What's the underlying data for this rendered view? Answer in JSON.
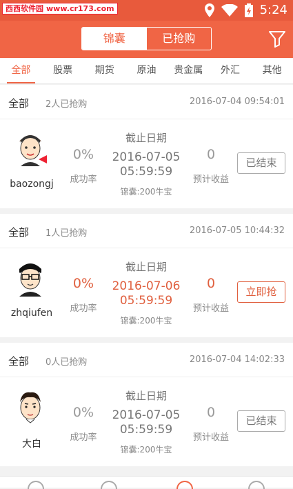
{
  "status_bar": {
    "watermark_left": "西西软件园",
    "watermark_site": "www.cr173.com",
    "time": "5:24"
  },
  "appbar": {
    "seg_left": "锦囊",
    "seg_right": "已抢购"
  },
  "tabs": [
    "全部",
    "股票",
    "期货",
    "原油",
    "贵金属",
    "外汇",
    "其他"
  ],
  "cards": [
    {
      "category": "全部",
      "count": "2人已抢购",
      "timestamp": "2016-07-04 09:54:01",
      "username": "baozongj",
      "rate": "0%",
      "rate_label": "成功率",
      "deadline_label": "截止日期",
      "deadline_date": "2016-07-05",
      "deadline_time": "05:59:59",
      "bag": "锦囊:200牛宝",
      "earnings": "0",
      "earnings_label": "预计收益",
      "action": "已结束"
    },
    {
      "category": "全部",
      "count": "1人已抢购",
      "timestamp": "2016-07-05 10:44:32",
      "username": "zhqiufen",
      "rate": "0%",
      "rate_label": "成功率",
      "deadline_label": "截止日期",
      "deadline_date": "2016-07-06",
      "deadline_time": "05:59:59",
      "bag": "锦囊:200牛宝",
      "earnings": "0",
      "earnings_label": "预计收益",
      "action": "立即抢"
    },
    {
      "category": "全部",
      "count": "0人已抢购",
      "timestamp": "2016-07-04 14:02:33",
      "username": "大白",
      "rate": "0%",
      "rate_label": "成功率",
      "deadline_label": "截止日期",
      "deadline_date": "2016-07-05",
      "deadline_time": "05:59:59",
      "bag": "锦囊:200牛宝",
      "earnings": "0",
      "earnings_label": "预计收益",
      "action": "已结束"
    }
  ],
  "colors": {
    "accent": "#f06545",
    "status_bar": "#e85a3c"
  }
}
